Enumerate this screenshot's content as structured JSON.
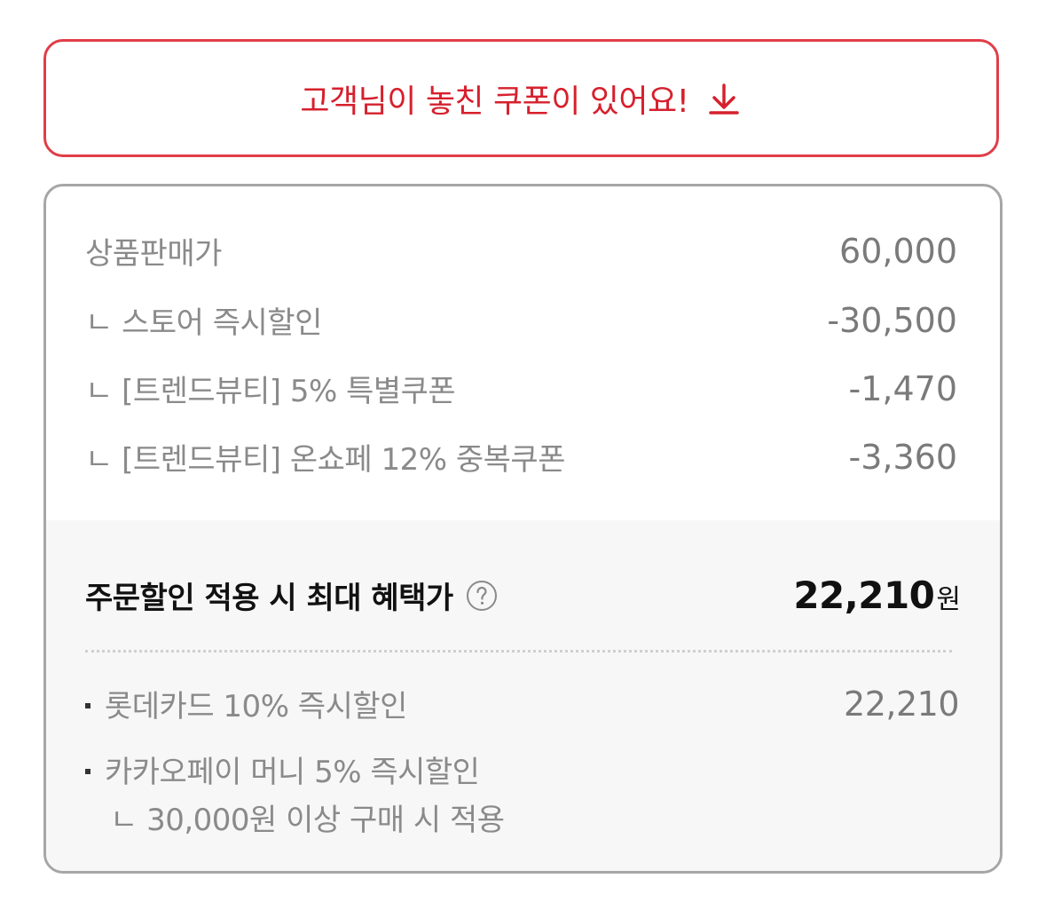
{
  "coupon_banner": {
    "text": "고객님이 놓친 쿠폰이 있어요!",
    "icon": "download-arrow-icon",
    "color": "#d6202d"
  },
  "price_breakdown": {
    "rows": [
      {
        "label": "상품판매가",
        "amount": "60,000"
      },
      {
        "label": "ㄴ 스토어 즉시할인",
        "amount": "-30,500"
      },
      {
        "label": "ㄴ [트렌드뷰티] 5% 특별쿠폰",
        "amount": "-1,470"
      },
      {
        "label": "ㄴ [트렌드뷰티] 온쇼페 12% 중복쿠폰",
        "amount": "-3,360"
      }
    ]
  },
  "max_benefit": {
    "label": "주문할인 적용 시 최대 혜택가",
    "amount": "22,210",
    "unit": "원",
    "help_icon": "question-circle-icon"
  },
  "payment_benefits": [
    {
      "label": "롯데카드 10% 즉시할인",
      "amount": "22,210"
    },
    {
      "label": "카카오페이 머니 5% 즉시할인",
      "amount": "",
      "note": "ㄴ 30,000원 이상 구매 시 적용"
    }
  ]
}
